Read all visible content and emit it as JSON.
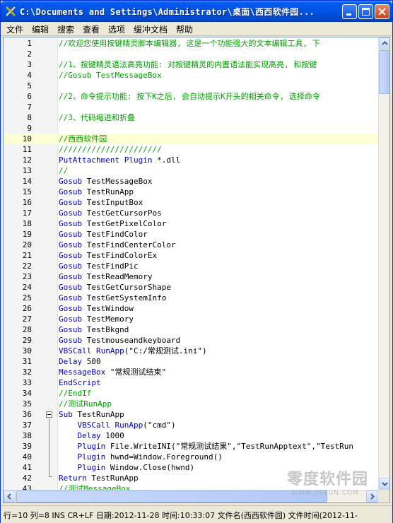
{
  "window": {
    "title": "C:\\Documents and Settings\\Administrator\\桌面\\西西软件园..."
  },
  "menu": [
    "文件",
    "编辑",
    "搜索",
    "查看",
    "选项",
    "缓冲文档",
    "帮助"
  ],
  "editor": {
    "current_line": 10,
    "lines": [
      [
        {
          "t": "//欢迎您使用按键精灵脚本编辑器, 这是一个功能强大的文本编辑工具, 下",
          "c": "cm"
        }
      ],
      [],
      [
        {
          "t": "//1、按键精灵语法高亮功能: 对按键精灵的内置语法能实现高亮, 和按键",
          "c": "cm"
        }
      ],
      [
        {
          "t": "//Gosub TestMessageBox",
          "c": "cm"
        }
      ],
      [],
      [
        {
          "t": "//2、命令提示功能: 按下K之后, 会自动提示K开头的相关命令, 选择命令",
          "c": "cm"
        }
      ],
      [],
      [
        {
          "t": "//3、代码缩进和折叠",
          "c": "cm"
        }
      ],
      [],
      [
        {
          "t": "//西西软件园",
          "c": "cm"
        }
      ],
      [
        {
          "t": "//////////////////////",
          "c": "cm"
        }
      ],
      [
        {
          "t": "PutAttachment",
          "c": "kw"
        },
        {
          "t": " "
        },
        {
          "t": "Plugin",
          "c": "kw"
        },
        {
          "t": " *.dll"
        }
      ],
      [
        {
          "t": "//",
          "c": "cm"
        }
      ],
      [
        {
          "t": "Gosub",
          "c": "kw"
        },
        {
          "t": " TestMessageBox"
        }
      ],
      [
        {
          "t": "Gosub",
          "c": "kw"
        },
        {
          "t": " TestRunApp"
        }
      ],
      [
        {
          "t": "Gosub",
          "c": "kw"
        },
        {
          "t": " TestInputBox"
        }
      ],
      [
        {
          "t": "Gosub",
          "c": "kw"
        },
        {
          "t": " TestGetCursorPos"
        }
      ],
      [
        {
          "t": "Gosub",
          "c": "kw"
        },
        {
          "t": " TestGetPixelColor"
        }
      ],
      [
        {
          "t": "Gosub",
          "c": "kw"
        },
        {
          "t": " TestFindColor"
        }
      ],
      [
        {
          "t": "Gosub",
          "c": "kw"
        },
        {
          "t": " TestFindCenterColor"
        }
      ],
      [
        {
          "t": "Gosub",
          "c": "kw"
        },
        {
          "t": " TestFindColorEx"
        }
      ],
      [
        {
          "t": "Gosub",
          "c": "kw"
        },
        {
          "t": " TestFindPic"
        }
      ],
      [
        {
          "t": "Gosub",
          "c": "kw"
        },
        {
          "t": " TestReadMemory"
        }
      ],
      [
        {
          "t": "Gosub",
          "c": "kw"
        },
        {
          "t": " TestGetCursorShape"
        }
      ],
      [
        {
          "t": "Gosub",
          "c": "kw"
        },
        {
          "t": " TestGetSystemInfo"
        }
      ],
      [
        {
          "t": "Gosub",
          "c": "kw"
        },
        {
          "t": " TestWindow"
        }
      ],
      [
        {
          "t": "Gosub",
          "c": "kw"
        },
        {
          "t": " TestMemory"
        }
      ],
      [
        {
          "t": "Gosub",
          "c": "kw"
        },
        {
          "t": " TestBkgnd"
        }
      ],
      [
        {
          "t": "Gosub",
          "c": "kw"
        },
        {
          "t": " Testmouseandkeyboard"
        }
      ],
      [
        {
          "t": "VBSCall",
          "c": "kw"
        },
        {
          "t": " "
        },
        {
          "t": "RunApp",
          "c": "kw"
        },
        {
          "t": "(\"C:/常规测试.ini\")"
        }
      ],
      [
        {
          "t": "Delay",
          "c": "kw"
        },
        {
          "t": " 500"
        }
      ],
      [
        {
          "t": "MessageBox",
          "c": "kw"
        },
        {
          "t": " \"常规测试结束\""
        }
      ],
      [
        {
          "t": "EndScript",
          "c": "kw"
        }
      ],
      [
        {
          "t": "//EndIf",
          "c": "cm"
        }
      ],
      [
        {
          "t": "//测试RunApp",
          "c": "cm"
        }
      ],
      [
        {
          "t": "Sub",
          "c": "kw"
        },
        {
          "t": " TestRunApp"
        }
      ],
      [
        {
          "t": "    "
        },
        {
          "t": "VBSCall",
          "c": "kw"
        },
        {
          "t": " "
        },
        {
          "t": "RunApp",
          "c": "kw"
        },
        {
          "t": "(\"cmd\")"
        }
      ],
      [
        {
          "t": "    "
        },
        {
          "t": "Delay",
          "c": "kw"
        },
        {
          "t": " 1000"
        }
      ],
      [
        {
          "t": "    "
        },
        {
          "t": "Plugin",
          "c": "kw"
        },
        {
          "t": " File.WriteINI(\"常规测试结果\",\"TestRunApptext\",\"TestRun"
        }
      ],
      [
        {
          "t": "    "
        },
        {
          "t": "Plugin",
          "c": "kw"
        },
        {
          "t": " hwnd=Window.Foreground()"
        }
      ],
      [
        {
          "t": "    "
        },
        {
          "t": "Plugin",
          "c": "kw"
        },
        {
          "t": " Window.Close(hwnd)"
        }
      ],
      [
        {
          "t": "Return",
          "c": "kw"
        },
        {
          "t": " TestRunApp"
        }
      ],
      [
        {
          "t": "//测试MessageBox",
          "c": "cm"
        }
      ]
    ]
  },
  "status": {
    "text": "行=10 列=8 INS CR+LF  日期:2012-11-28 时间:10:33:07 文件名(西西软件园) 文件时间(2012-11-"
  },
  "watermark": {
    "title": "零度软件园",
    "url": "WWW.0SSUN.COM"
  }
}
